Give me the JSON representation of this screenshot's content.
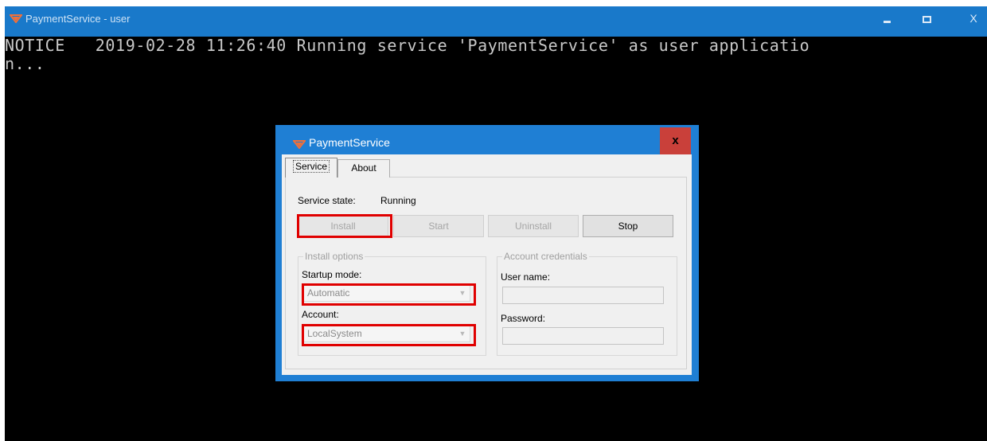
{
  "console": {
    "title": "PaymentService - user",
    "line1": "NOTICE   2019-02-28 11:26:40 Running service 'PaymentService' as user applicatio",
    "line2": "n...",
    "controls": {
      "close": "X"
    }
  },
  "dialog": {
    "title": "PaymentService",
    "close": "x",
    "tabs": [
      {
        "label": "Service",
        "active": true
      },
      {
        "label": "About",
        "active": false
      }
    ],
    "service_state_label": "Service state:",
    "service_state_value": "Running",
    "buttons": {
      "install": "Install",
      "start": "Start",
      "uninstall": "Uninstall",
      "stop": "Stop"
    },
    "install_options": {
      "legend": "Install options",
      "startup_mode_label": "Startup mode:",
      "startup_mode_value": "Automatic",
      "account_label": "Account:",
      "account_value": "LocalSystem"
    },
    "account_credentials": {
      "legend": "Account credentials",
      "username_label": "User name:",
      "username_value": "",
      "password_label": "Password:",
      "password_value": ""
    }
  },
  "colors": {
    "title_bar": "#1979ca",
    "dialog_frame": "#1f7fd4",
    "close_button": "#c9403a",
    "highlight": "#e00000",
    "app_icon": "#f0703a"
  }
}
